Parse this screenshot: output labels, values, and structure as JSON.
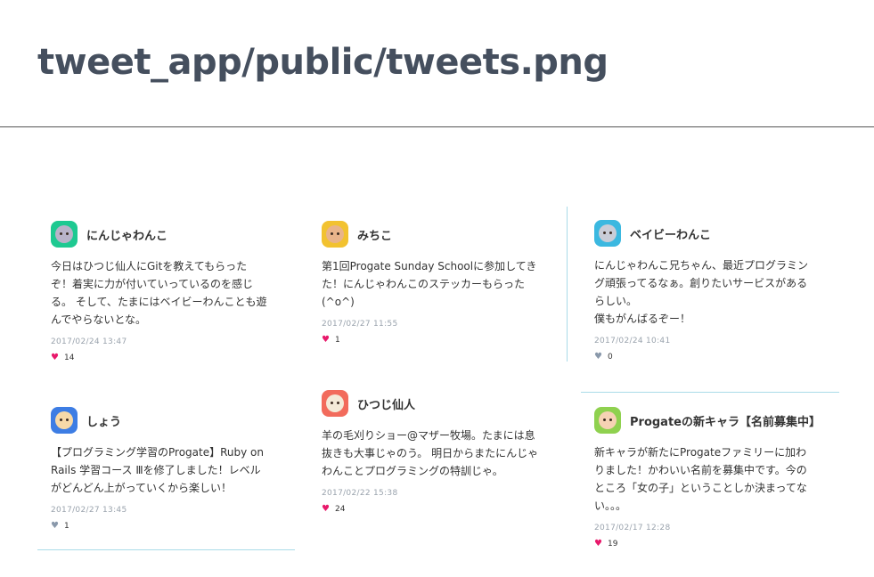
{
  "page": {
    "title": "tweet_app/public/tweets.png"
  },
  "colors": {
    "like_active": "#e8196b",
    "like_inactive": "#8a99ab",
    "separator": "#a9dbe8"
  },
  "tweets": [
    {
      "user": "にんじゃわんこ",
      "avatar_icon": "ninja-dog-avatar-icon",
      "avatar_color": "#1ec991",
      "content": "今日はひつじ仙人にGitを教えてもらった\nぞ！着実に力が付いていっているのを感じ\nる。 そして、たまにはベイビーわんことも遊\nんでやらないとな。",
      "date": "2017/02/24 13:47",
      "likes": "14",
      "liked": true
    },
    {
      "user": "しょう",
      "avatar_icon": "shou-avatar-icon",
      "avatar_color": "#3d7de4",
      "content": "【プログラミング学習のProgate】Ruby on\nRails 学習コース Ⅲを修了しました！レベル\nがどんどん上がっていくから楽しい！",
      "date": "2017/02/27 13:45",
      "likes": "1",
      "liked": false
    },
    {
      "user": "みちこ",
      "avatar_icon": "michiko-avatar-icon",
      "avatar_color": "#f2c230",
      "content": "第1回Progate Sunday Schoolに参加してき\nた！にんじゃわんこのステッカーもらった\n(^o^)",
      "date": "2017/02/27 11:55",
      "likes": "1",
      "liked": true
    },
    {
      "user": "ひつじ仙人",
      "avatar_icon": "sheep-sage-avatar-icon",
      "avatar_color": "#f26b5c",
      "content": "羊の毛刈りショー@マザー牧場。たまには息\n抜きも大事じゃのう。 明日からまたにんじゃ\nわんことプログラミングの特訓じゃ。",
      "date": "2017/02/22 15:38",
      "likes": "24",
      "liked": true
    },
    {
      "user": "ベイビーわんこ",
      "avatar_icon": "baby-dog-avatar-icon",
      "avatar_color": "#3bb8e0",
      "content": "にんじゃわんこ兄ちゃん、最近プログラミン\nグ頑張ってるなぁ。創りたいサービスがある\nらしい。\n僕もがんばるぞー！",
      "date": "2017/02/24 10:41",
      "likes": "0",
      "liked": false
    },
    {
      "user": "Progateの新キャラ【名前募集中】",
      "avatar_icon": "new-character-avatar-icon",
      "avatar_color": "#8fd14f",
      "content": "新キャラが新たにProgateファミリーに加わ\nりました！かわいい名前を募集中です。今の\nところ「女の子」ということしか決まってな\nい。。。",
      "date": "2017/02/17 12:28",
      "likes": "19",
      "liked": true
    }
  ]
}
